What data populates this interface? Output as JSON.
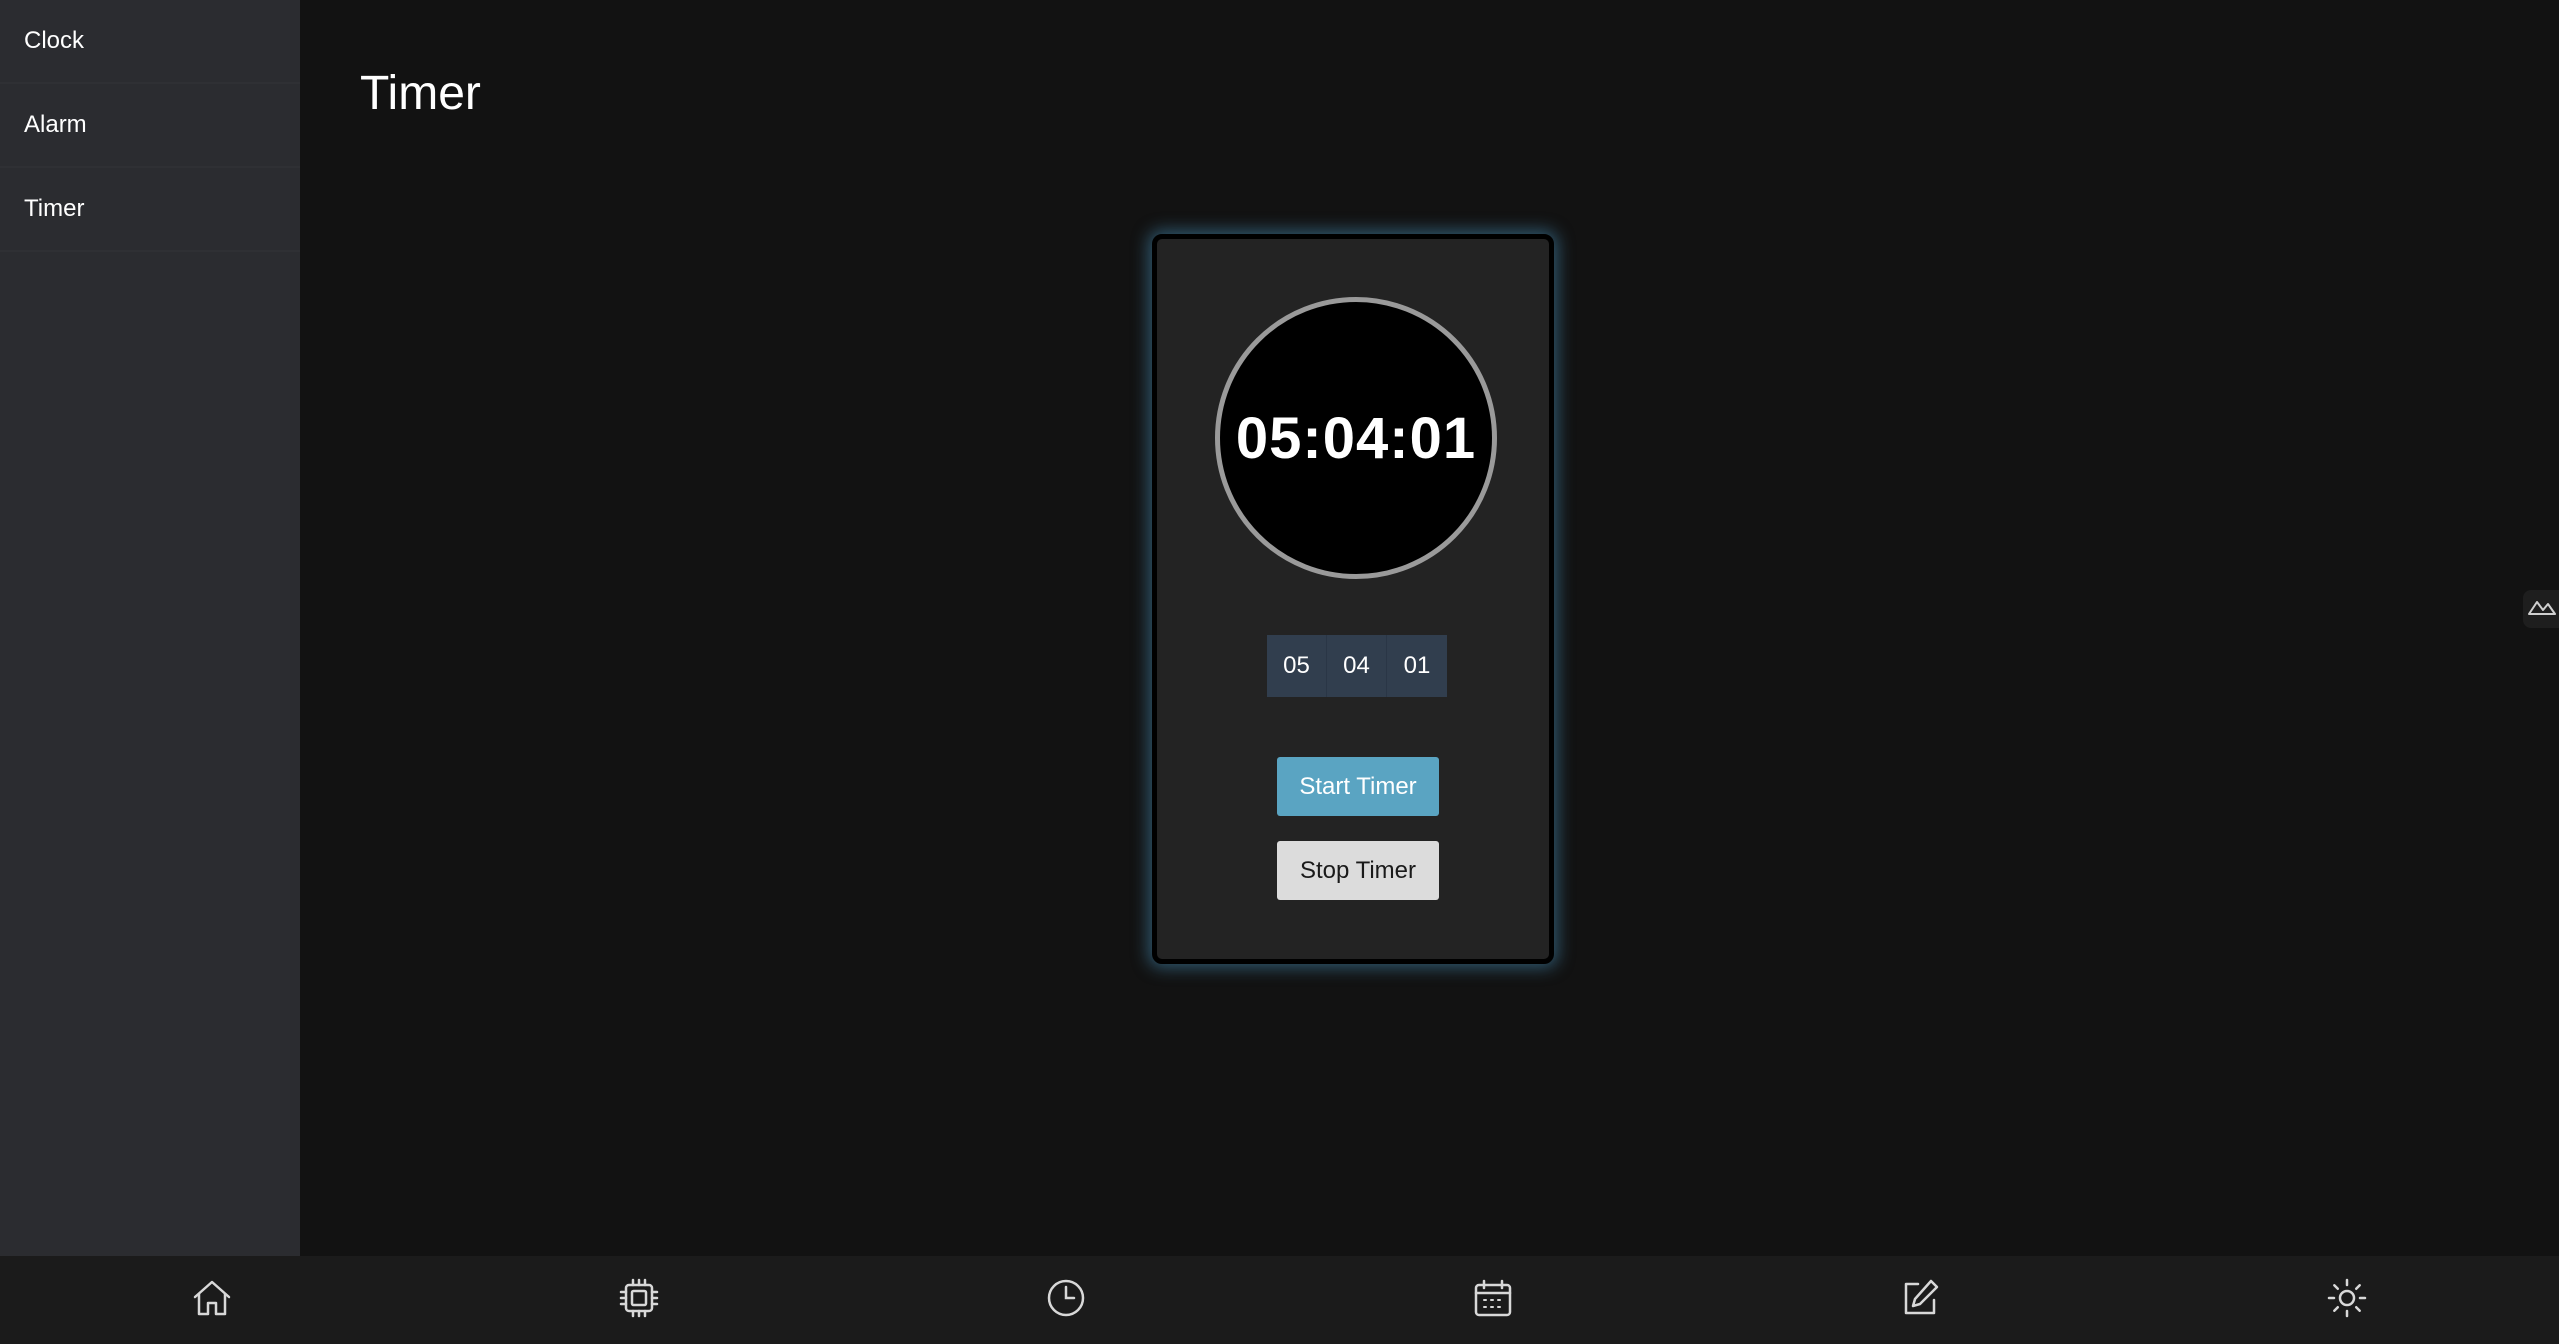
{
  "sidebar": {
    "items": [
      {
        "label": "Clock"
      },
      {
        "label": "Alarm"
      },
      {
        "label": "Timer"
      }
    ]
  },
  "main": {
    "title": "Timer"
  },
  "timer": {
    "display": "05:04:01",
    "hours": "05",
    "minutes": "04",
    "seconds": "01",
    "start_label": "Start Timer",
    "stop_label": "Stop Timer"
  },
  "bottom_nav": {
    "icons": [
      "home-icon",
      "chip-icon",
      "clock-icon",
      "calendar-icon",
      "edit-icon",
      "brightness-icon"
    ]
  },
  "colors": {
    "background": "#121212",
    "sidebar": "#2b2c30",
    "card": "#232323",
    "start_button": "#5aa4c2",
    "stop_button": "#dcdcdc",
    "time_cell": "#313e4e",
    "glow": "#468cb4"
  }
}
